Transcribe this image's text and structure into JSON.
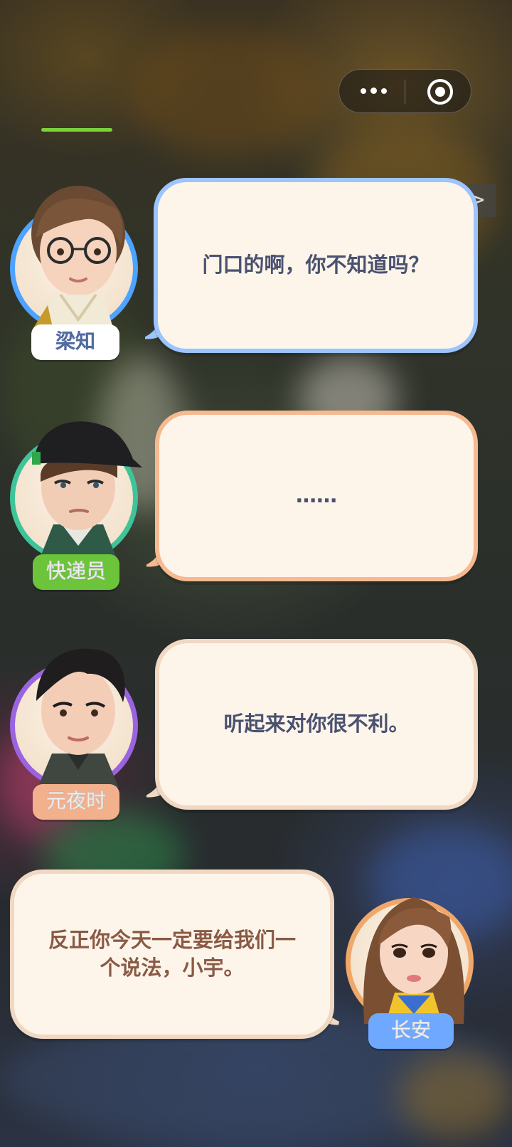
{
  "hud": {
    "more_icon": "more-dots-icon",
    "close_icon": "target-circle-icon",
    "skip_label": ">>"
  },
  "dialogues": [
    {
      "speaker": "梁知",
      "text": "门口的啊，你不知道吗？",
      "ring_color": "#4da3ff",
      "tag_color": "#ffffff",
      "tag_text_color": "#5a78b8"
    },
    {
      "speaker": "快递员",
      "text": "……",
      "ring_color": "#3fc49a",
      "tag_color": "#6cc43a",
      "tag_text_color": "#ffffff"
    },
    {
      "speaker": "元夜时",
      "text": "听起来对你很不利。",
      "ring_color": "#9a64e0",
      "tag_color": "#f3b08c",
      "tag_text_color": "#ffffff"
    },
    {
      "speaker": "长安",
      "text": "反正你今天一定要给我们一个说法，小宇。",
      "ring_color": "#f0a76a",
      "tag_color": "#6fa8ff",
      "tag_text_color": "#ffffff"
    }
  ],
  "colors": {
    "bubble_bg": "#fdf5ea",
    "bubble_text": "#4b5170",
    "bubble_text_changan": "#8a5a45"
  }
}
